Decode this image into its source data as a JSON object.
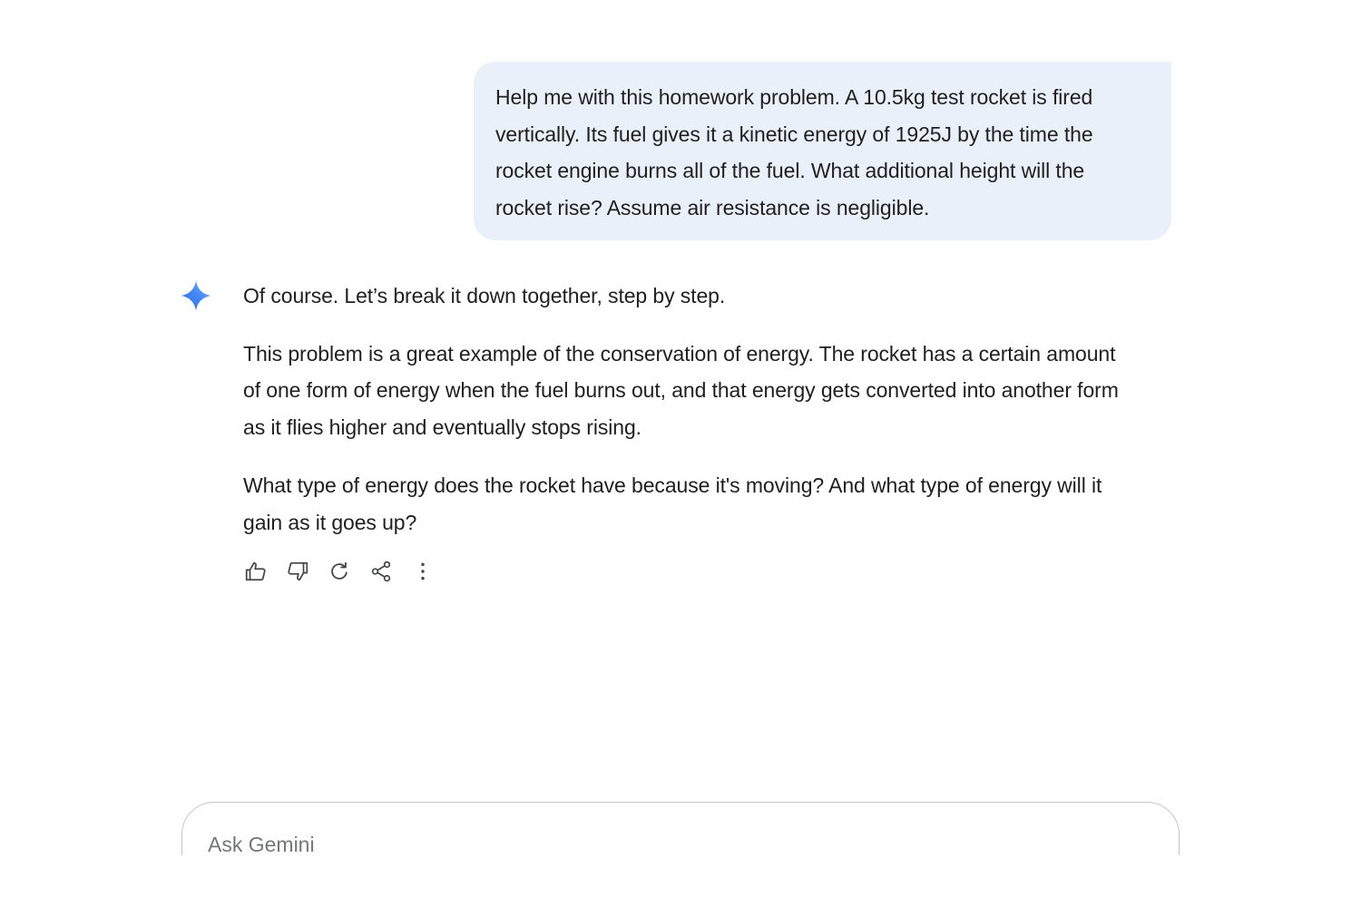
{
  "user_message": {
    "lines": [
      "Help me with this homework problem. A 10.5kg test rocket is fired",
      "vertically. Its fuel gives it a kinetic energy of 1925J by the time the",
      "rocket engine burns all of the fuel. What additional height will the",
      "rocket rise? Assume air resistance is negligible."
    ]
  },
  "response": {
    "intro": "Of course. Let’s break it down together, step by step.",
    "para1_lines": [
      "This problem is a great example of the conservation of energy. The rocket has a certain amount",
      "of one form of energy when the fuel burns out, and that energy gets converted into another form",
      "as it flies higher and eventually stops rising."
    ],
    "para2_lines": [
      "What type of energy does the rocket have because it's moving? And what type of energy will it",
      "gain as it goes up?"
    ]
  },
  "actions": {
    "icons": [
      "thumbs-up-icon",
      "thumbs-down-icon",
      "regenerate-icon",
      "share-icon",
      "more-options-icon"
    ]
  },
  "input": {
    "placeholder": "Ask Gemini",
    "value": ""
  },
  "colors": {
    "user_bubble_bg": "#eaf0f9",
    "text": "#1f1f1f",
    "icon": "#444746",
    "spark_start": "#4285f4",
    "spark_end": "#6fa8f7",
    "input_border": "#c4c7c5",
    "placeholder": "#747775"
  }
}
